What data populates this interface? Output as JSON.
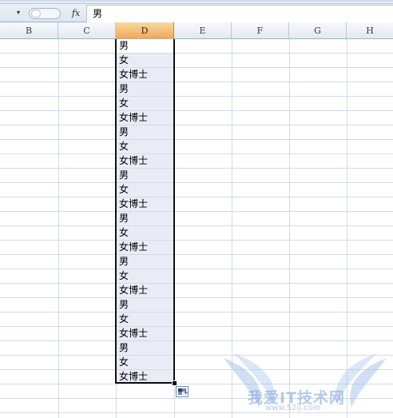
{
  "formula_bar": {
    "name_box_dropdown": "▾",
    "fx_label": "fx",
    "content": "男"
  },
  "columns": [
    {
      "label": "B",
      "selected": false
    },
    {
      "label": "C",
      "selected": false
    },
    {
      "label": "D",
      "selected": true
    },
    {
      "label": "E",
      "selected": false
    },
    {
      "label": "F",
      "selected": false
    },
    {
      "label": "G",
      "selected": false
    },
    {
      "label": "H",
      "selected": false
    }
  ],
  "column_d_cells": [
    "男",
    "女",
    "女博士",
    "男",
    "女",
    "女博士",
    "男",
    "女",
    "女博士",
    "男",
    "女",
    "女博士",
    "男",
    "女",
    "女博士",
    "男",
    "女",
    "女博士",
    "男",
    "女",
    "女博士",
    "男",
    "女",
    "女博士"
  ],
  "colors": {
    "selected_header": "#f2a757",
    "selection_fill": "#e9ecf5",
    "gridline": "#d4dbe5"
  },
  "watermark": {
    "text": "我爱IT技术网",
    "url": "www.52ij.com"
  }
}
